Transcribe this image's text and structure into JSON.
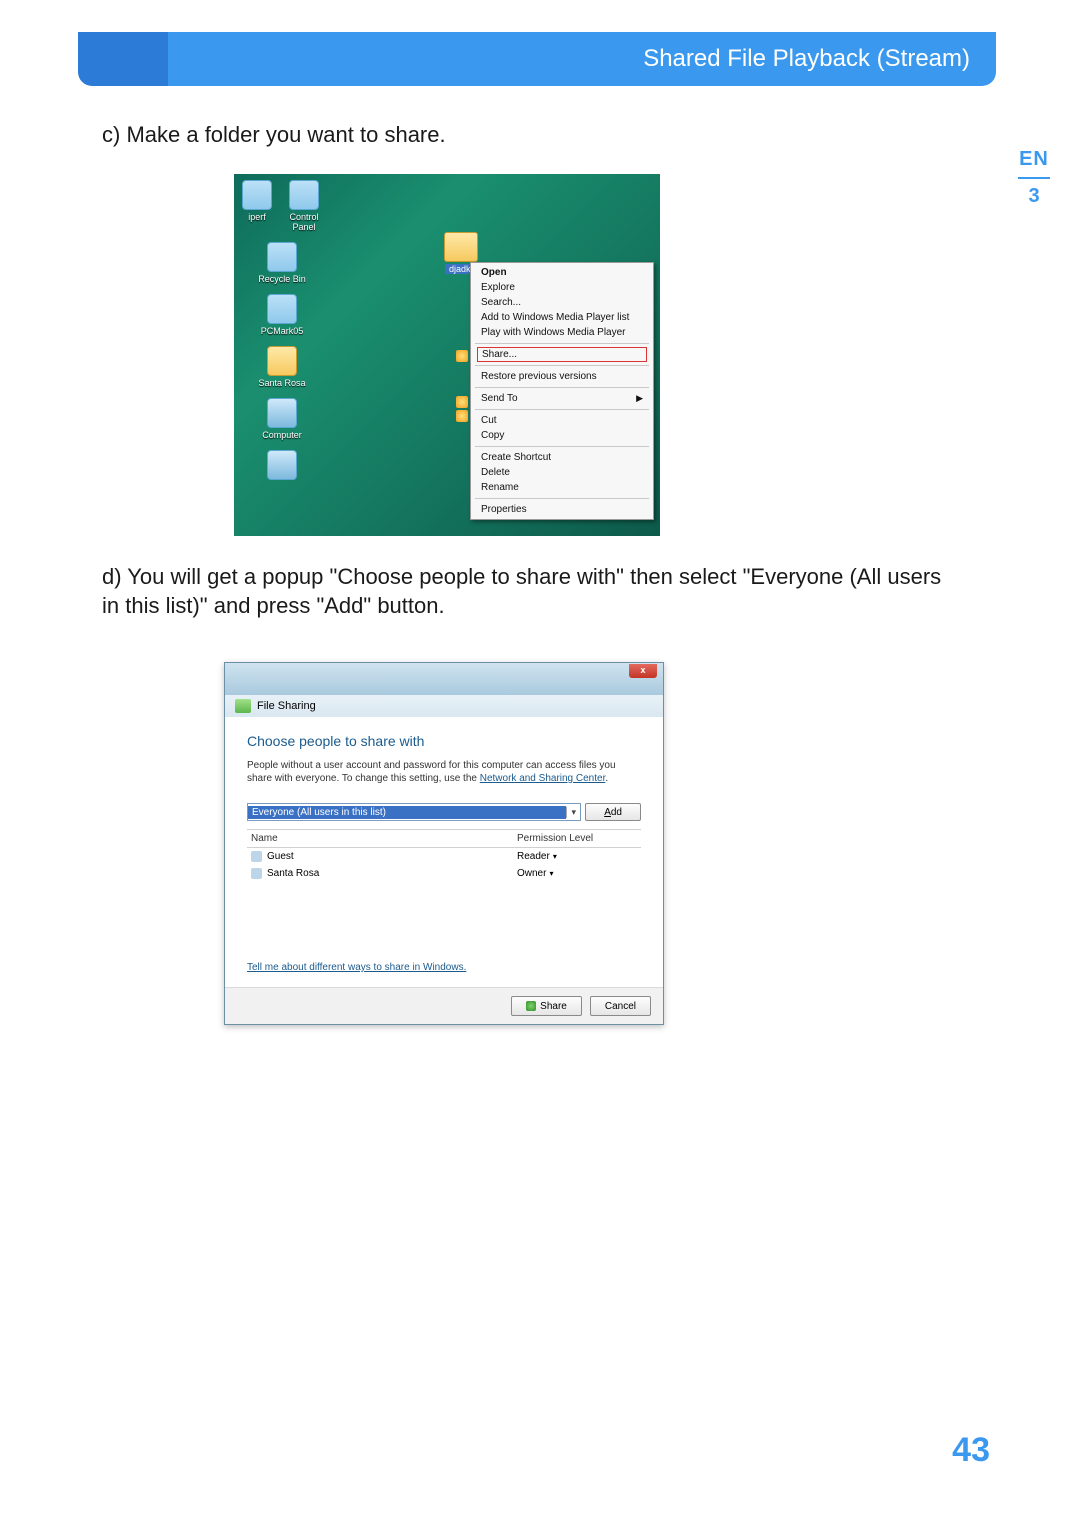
{
  "header": {
    "title": "Shared File Playback (Stream)"
  },
  "side": {
    "lang": "EN",
    "chapter": "3"
  },
  "page_number": "43",
  "steps": {
    "c": "c) Make a folder you want to share.",
    "d": "d) You will get a popup \"Choose people to share with\" then select \"Everyone (All users in this list)\" and press \"Add\" button."
  },
  "screenshot1": {
    "desktop_icons": [
      {
        "label": "iperf",
        "kind": "file"
      },
      {
        "label": "Control Panel",
        "kind": "file"
      },
      {
        "label": "Recycle Bin",
        "kind": "bin"
      },
      {
        "label": "PCMark05",
        "kind": "app"
      },
      {
        "label": "Santa Rosa",
        "kind": "folder"
      },
      {
        "label": "Computer",
        "kind": "monitor"
      }
    ],
    "selected_folder": "djadkf",
    "context_menu": {
      "items": [
        {
          "label": "Open",
          "bold": true
        },
        {
          "label": "Explore"
        },
        {
          "label": "Search..."
        },
        {
          "label": "Add to Windows Media Player list"
        },
        {
          "label": "Play with Windows Media Player"
        },
        {
          "sep": true
        },
        {
          "label": "Share...",
          "highlight": true
        },
        {
          "sep": true
        },
        {
          "label": "Restore previous versions"
        },
        {
          "sep": true
        },
        {
          "label": "Send To",
          "submenu": true
        },
        {
          "sep": true
        },
        {
          "label": "Cut"
        },
        {
          "label": "Copy"
        },
        {
          "sep": true
        },
        {
          "label": "Create Shortcut"
        },
        {
          "label": "Delete"
        },
        {
          "label": "Rename"
        },
        {
          "sep": true
        },
        {
          "label": "Properties"
        }
      ]
    }
  },
  "screenshot2": {
    "breadcrumb": "File Sharing",
    "title": "Choose people to share with",
    "description_pre": "People without a user account and password for this computer can access files you share with everyone. To change this setting, use the ",
    "description_link": "Network and Sharing Center",
    "description_post": ".",
    "combo_value": "Everyone (All users in this list)",
    "add_label": "Add",
    "columns": {
      "name": "Name",
      "perm": "Permission Level"
    },
    "rows": [
      {
        "name": "Guest",
        "perm": "Reader"
      },
      {
        "name": "Santa Rosa",
        "perm": "Owner"
      }
    ],
    "help_link": "Tell me about different ways to share in Windows.",
    "buttons": {
      "share": "Share",
      "cancel": "Cancel"
    },
    "close_glyph": "x"
  }
}
